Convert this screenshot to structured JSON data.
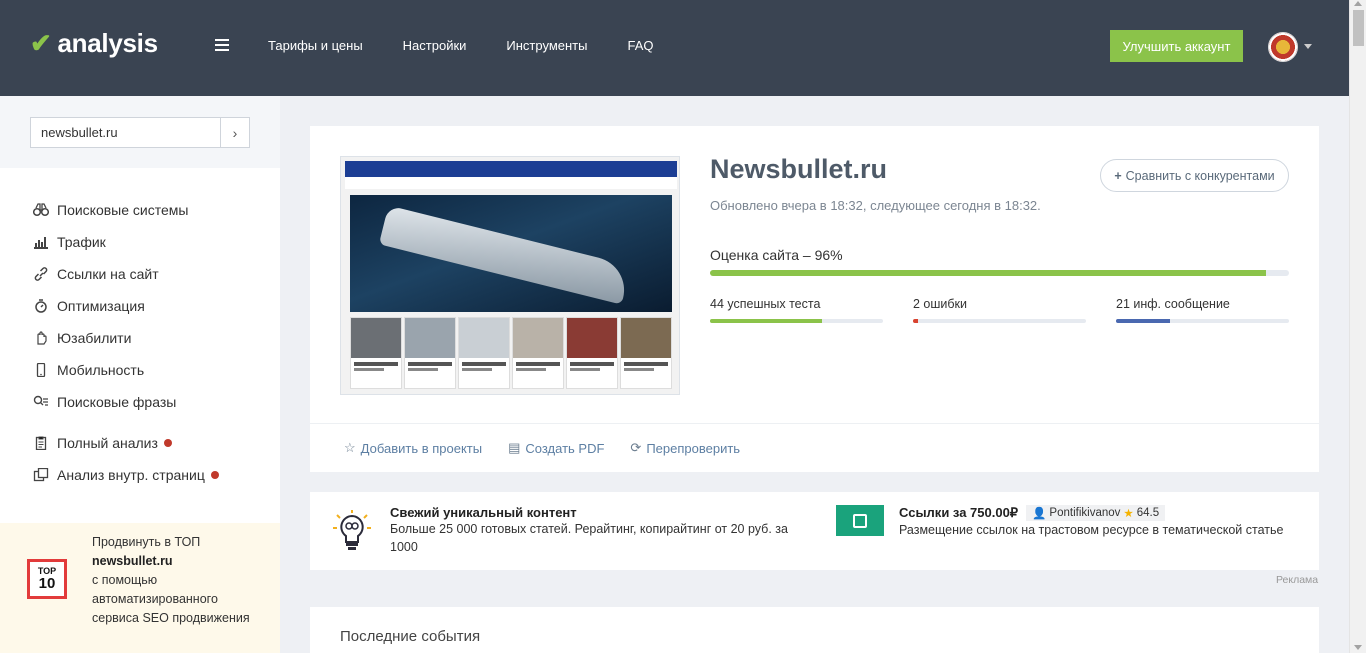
{
  "header": {
    "logo_text": "analysis",
    "nav": [
      "Тарифы и цены",
      "Настройки",
      "Инструменты",
      "FAQ"
    ],
    "upgrade_label": "Улучшить аккаунт",
    "accent": "#8bc34a",
    "bg": "#3a4452"
  },
  "sidebar": {
    "search_value": "newsbullet.ru",
    "search_btn": "›",
    "items": [
      {
        "label": "Поисковые системы",
        "icon": "binoculars-icon"
      },
      {
        "label": "Трафик",
        "icon": "bar-chart-icon"
      },
      {
        "label": "Ссылки на сайт",
        "icon": "link-icon"
      },
      {
        "label": "Оптимизация",
        "icon": "stopwatch-icon"
      },
      {
        "label": "Юзабилити",
        "icon": "hand-icon"
      },
      {
        "label": "Мобильность",
        "icon": "mobile-icon"
      },
      {
        "label": "Поисковые фразы",
        "icon": "search-list-icon"
      }
    ],
    "extra_items": [
      {
        "label": "Полный анализ",
        "icon": "clipboard-icon"
      },
      {
        "label": "Анализ внутр. страниц",
        "icon": "pages-icon"
      }
    ],
    "promo": {
      "line1": "Продвинуть в ТОП",
      "site": "newsbullet.ru",
      "line3": "с помощью",
      "line4": "автоматизированного",
      "line5": "сервиса SEO продвижения",
      "badge_top": "TOP",
      "badge_num": "10"
    }
  },
  "main": {
    "site_title": "Newsbullet.ru",
    "updated": "Обновлено вчера в 18:32, следующее сегодня в 18:32.",
    "compare_label": "Сравнить с конкурентами",
    "score_label": "Оценка сайта – 96%",
    "score_value": 0.96,
    "stats": [
      {
        "label": "44 успешных теста",
        "color": "#8bc34a",
        "value": 0.65
      },
      {
        "label": "2 ошибки",
        "color": "#d9432f",
        "value": 0.03
      },
      {
        "label": "21 инф. сообщение",
        "color": "#4a68b0",
        "value": 0.31
      }
    ],
    "actions": [
      {
        "label": "Добавить в проекты",
        "icon": "star-outline-icon",
        "glyph": "☆"
      },
      {
        "label": "Создать PDF",
        "icon": "document-icon",
        "glyph": "▤"
      },
      {
        "label": "Перепроверить",
        "icon": "refresh-icon",
        "glyph": "⟳"
      }
    ]
  },
  "ads": {
    "ad1_title": "Свежий уникальный контент",
    "ad1_desc": "Больше 25 000 готовых статей. Рерайтинг, копирайтинг от 20 руб. за 1000",
    "ad2_title": "Ссылки за 750.00₽",
    "ad2_user": "Pontifikivanov",
    "ad2_rating": "64.5",
    "ad2_desc": "Размещение ссылок на трастовом ресурсе в тематической статье",
    "label": "Реклама"
  },
  "events": {
    "title": "Последние события"
  }
}
